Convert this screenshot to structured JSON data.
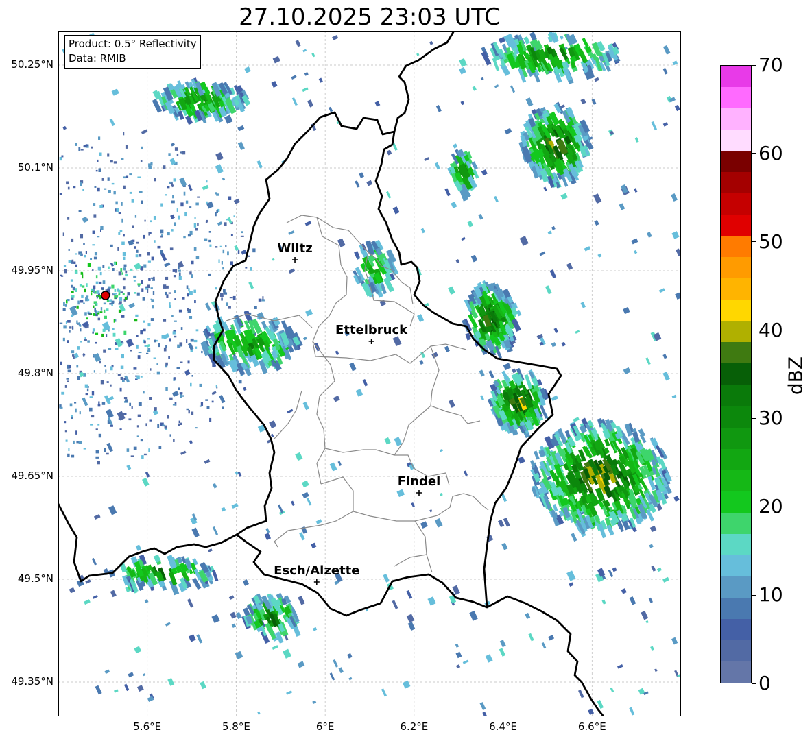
{
  "title": "27.10.2025 23:03 UTC",
  "info": {
    "product": "Product: 0.5° Reflectivity",
    "data": "Data: RMIB"
  },
  "map": {
    "lon_range": [
      5.4,
      6.8
    ],
    "lat_range": [
      49.3,
      50.3
    ],
    "lat_ticks": [
      {
        "value": 50.25,
        "label": "50.25°N"
      },
      {
        "value": 50.1,
        "label": "50.1°N"
      },
      {
        "value": 49.95,
        "label": "49.95°N"
      },
      {
        "value": 49.8,
        "label": "49.8°N"
      },
      {
        "value": 49.65,
        "label": "49.65°N"
      },
      {
        "value": 49.5,
        "label": "49.5°N"
      },
      {
        "value": 49.35,
        "label": "49.35°N"
      }
    ],
    "lon_ticks": [
      {
        "value": 5.6,
        "label": "5.6°E"
      },
      {
        "value": 5.8,
        "label": "5.8°E"
      },
      {
        "value": 6.0,
        "label": "6°E"
      },
      {
        "value": 6.2,
        "label": "6.2°E"
      },
      {
        "value": 6.4,
        "label": "6.4°E"
      },
      {
        "value": 6.6,
        "label": "6.6°E"
      }
    ],
    "grid": true,
    "radar_site": {
      "lon": 5.506,
      "lat": 49.914
    },
    "cities": [
      {
        "name": "Wiltz",
        "lon": 5.932,
        "lat": 49.966
      },
      {
        "name": "Ettelbruck",
        "lon": 6.104,
        "lat": 49.847
      },
      {
        "name": "Findel",
        "lon": 6.211,
        "lat": 49.626
      },
      {
        "name": "Esch/Alzette",
        "lon": 5.981,
        "lat": 49.496
      }
    ]
  },
  "colorbar": {
    "label": "dBZ",
    "min": 0,
    "max": 70,
    "ticks": [
      "0",
      "10",
      "20",
      "30",
      "40",
      "50",
      "60",
      "70"
    ],
    "colors": [
      "#6476a8",
      "#526aa4",
      "#4460a6",
      "#4a79b0",
      "#5a9ac4",
      "#66bedb",
      "#5cd8c4",
      "#3ed56c",
      "#13c81e",
      "#15b816",
      "#12a712",
      "#109810",
      "#0c880c",
      "#0a7a0a",
      "#075f07",
      "#3f7a11",
      "#b0b000",
      "#ffd700",
      "#ffb400",
      "#ff9b00",
      "#ff7b00",
      "#e00000",
      "#c50000",
      "#a40000",
      "#7a0000",
      "#ffdcff",
      "#ffb2ff",
      "#ff6aff",
      "#e83ae8"
    ]
  }
}
